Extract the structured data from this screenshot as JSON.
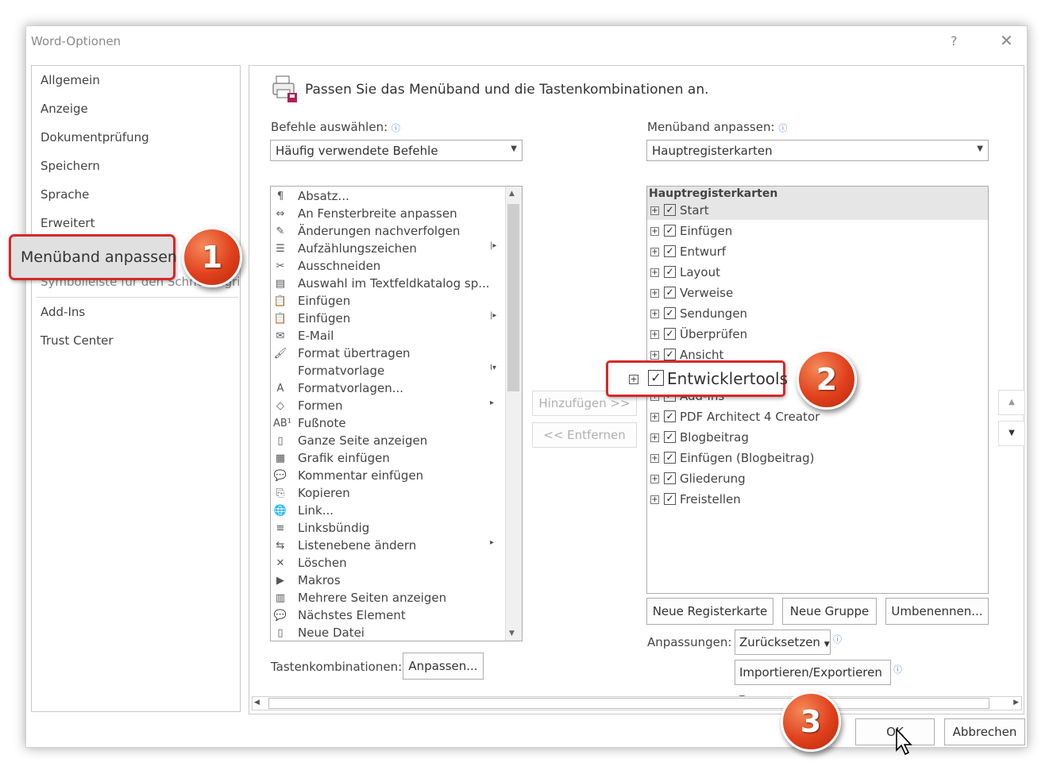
{
  "window": {
    "title": "Word-Optionen",
    "help": "?",
    "close": "✕"
  },
  "nav": {
    "items": [
      "Allgemein",
      "Anzeige",
      "Dokumentprüfung",
      "Speichern",
      "Sprache",
      "Erweitert",
      "Menüband anpassen",
      "Symbolleiste für den Schnellzugriff",
      "Add-Ins",
      "Trust Center"
    ],
    "selected": "Menüband anpassen"
  },
  "callouts": {
    "one": "1",
    "two": "2",
    "three": "3"
  },
  "main": {
    "heading": "Passen Sie das Menüband und die Tastenkombinationen an.",
    "commands_label": "Befehle auswählen:",
    "commands_value": "Häufig verwendete Befehle",
    "ribbon_label": "Menüband anpassen:",
    "ribbon_value": "Hauptregisterkarten",
    "commands": [
      {
        "label": "Absatz...",
        "icon": "¶",
        "sub": ""
      },
      {
        "label": "An Fensterbreite anpassen",
        "icon": "⇔",
        "sub": ""
      },
      {
        "label": "Änderungen nachverfolgen",
        "icon": "✎",
        "sub": ""
      },
      {
        "label": "Aufzählungszeichen",
        "icon": "☰",
        "sub": "|▸"
      },
      {
        "label": "Ausschneiden",
        "icon": "✂",
        "sub": ""
      },
      {
        "label": "Auswahl im Textfeldkatalog sp...",
        "icon": "▤",
        "sub": ""
      },
      {
        "label": "Einfügen",
        "icon": "📋",
        "sub": ""
      },
      {
        "label": "Einfügen",
        "icon": "📋",
        "sub": "|▸"
      },
      {
        "label": "E-Mail",
        "icon": "✉",
        "sub": ""
      },
      {
        "label": "Format übertragen",
        "icon": "🖌",
        "sub": ""
      },
      {
        "label": "Formatvorlage",
        "icon": "",
        "sub": "I▾"
      },
      {
        "label": "Formatvorlagen...",
        "icon": "A",
        "sub": ""
      },
      {
        "label": "Formen",
        "icon": "◇",
        "sub": "▸"
      },
      {
        "label": "Fußnote",
        "icon": "AB¹",
        "sub": ""
      },
      {
        "label": "Ganze Seite anzeigen",
        "icon": "▯",
        "sub": ""
      },
      {
        "label": "Grafik einfügen",
        "icon": "▦",
        "sub": ""
      },
      {
        "label": "Kommentar einfügen",
        "icon": "💬",
        "sub": ""
      },
      {
        "label": "Kopieren",
        "icon": "⎘",
        "sub": ""
      },
      {
        "label": "Link...",
        "icon": "🌐",
        "sub": ""
      },
      {
        "label": "Linksbündig",
        "icon": "≡",
        "sub": ""
      },
      {
        "label": "Listenebene ändern",
        "icon": "⇆",
        "sub": "▸"
      },
      {
        "label": "Löschen",
        "icon": "✕",
        "sub": ""
      },
      {
        "label": "Makros",
        "icon": "▶",
        "sub": ""
      },
      {
        "label": "Mehrere Seiten anzeigen",
        "icon": "▥",
        "sub": ""
      },
      {
        "label": "Nächstes Element",
        "icon": "💬",
        "sub": ""
      },
      {
        "label": "Neue Datei",
        "icon": "▯",
        "sub": ""
      }
    ],
    "add_button": "Hinzufügen >>",
    "remove_button": "<< Entfernen",
    "tree_header": "Hauptregisterkarten",
    "tabs": [
      {
        "label": "Start",
        "checked": true
      },
      {
        "label": "Einfügen",
        "checked": true
      },
      {
        "label": "Entwurf",
        "checked": true
      },
      {
        "label": "Layout",
        "checked": true
      },
      {
        "label": "Verweise",
        "checked": true
      },
      {
        "label": "Sendungen",
        "checked": true
      },
      {
        "label": "Überprüfen",
        "checked": true
      },
      {
        "label": "Ansicht",
        "checked": true
      },
      {
        "label": "Entwicklertools",
        "checked": true
      },
      {
        "label": "Add-Ins",
        "checked": true
      },
      {
        "label": "PDF Architect 4 Creator",
        "checked": true
      },
      {
        "label": "Blogbeitrag",
        "checked": true
      },
      {
        "label": "Einfügen (Blogbeitrag)",
        "checked": true
      },
      {
        "label": "Gliederung",
        "checked": true
      },
      {
        "label": "Freistellen",
        "checked": true
      }
    ],
    "developer_tab": "Entwicklertools",
    "new_tab_button": "Neue Registerkarte",
    "new_group_button": "Neue Gruppe",
    "rename_button": "Umbenennen...",
    "customizations_label": "Anpassungen:",
    "reset_button": "Zurücksetzen",
    "import_export_button": "Importieren/Exportieren",
    "shortcuts_label": "Tastenkombinationen:",
    "customize_button": "Anpassen..."
  },
  "footer": {
    "ok": "OK",
    "cancel": "Abbrechen"
  }
}
